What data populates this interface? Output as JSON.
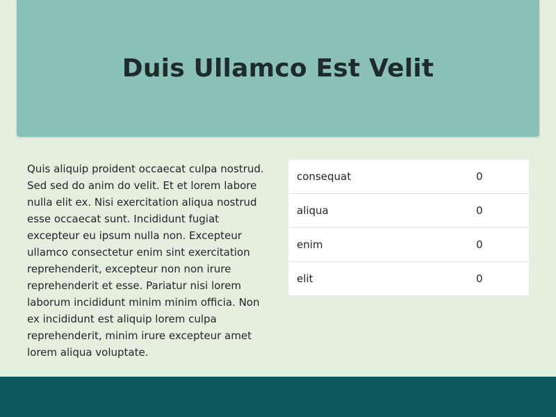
{
  "hero": {
    "title": "Duis Ullamco Est Velit"
  },
  "main": {
    "paragraph": "Quis aliquip proident occaecat culpa nostrud. Sed sed do anim do velit. Et et lorem labore nulla elit ex. Nisi exercitation aliqua nostrud esse occaecat sunt. Incididunt fugiat excepteur eu ipsum nulla non. Excepteur ullamco consectetur enim sint exercitation reprehenderit, excepteur non non irure reprehenderit et esse. Pariatur nisi lorem laborum incididunt minim minim officia. Non ex incididunt est aliquip lorem culpa reprehenderit, minim irure excepteur amet lorem aliqua voluptate."
  },
  "table": {
    "rows": [
      {
        "label": "consequat",
        "value": "0"
      },
      {
        "label": "aliqua",
        "value": "0"
      },
      {
        "label": "enim",
        "value": "0"
      },
      {
        "label": "elit",
        "value": "0"
      }
    ]
  },
  "colors": {
    "page_background": "#e5efe0",
    "hero_background": "#8ac0b6",
    "footer_background": "#0c5a5f"
  }
}
